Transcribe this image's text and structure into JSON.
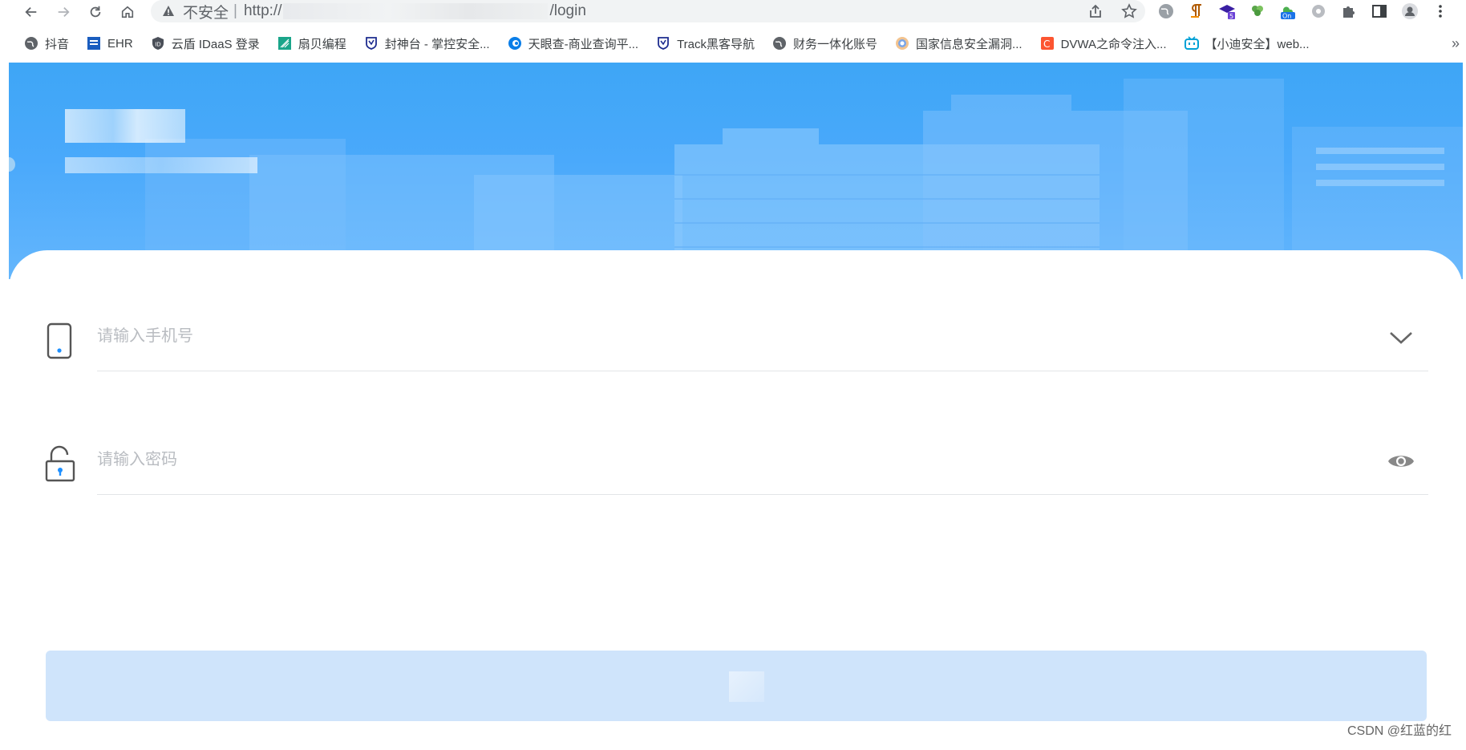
{
  "browser": {
    "security_label": "不安全",
    "separator": "|",
    "url_prefix": "http://",
    "url_suffix": "/login"
  },
  "bookmarks": [
    {
      "label": "抖音",
      "icon": "globe-icon"
    },
    {
      "label": "EHR",
      "icon": "ehr-icon"
    },
    {
      "label": "云盾 IDaaS 登录",
      "icon": "shield-icon"
    },
    {
      "label": "扇贝编程",
      "icon": "shanbay-icon"
    },
    {
      "label": "封神台 - 掌控安全...",
      "icon": "fst-shield-icon"
    },
    {
      "label": "天眼查-商业查询平...",
      "icon": "tianyancha-icon"
    },
    {
      "label": "Track黑客导航",
      "icon": "track-shield-icon"
    },
    {
      "label": "财务一体化账号",
      "icon": "globe-icon"
    },
    {
      "label": "国家信息安全漏洞...",
      "icon": "cnnvd-icon"
    },
    {
      "label": "DVWA之命令注入...",
      "icon": "csdn-icon"
    },
    {
      "label": "【小迪安全】web...",
      "icon": "bilibili-icon"
    }
  ],
  "bookmarks_more": "»",
  "login": {
    "phone_placeholder": "请输入手机号",
    "password_placeholder": "请输入密码"
  },
  "colors": {
    "hero": "#4aa9fb",
    "accent": "#1e90ff",
    "button": "#cfe4fb"
  },
  "watermark": "CSDN @红蓝的红"
}
